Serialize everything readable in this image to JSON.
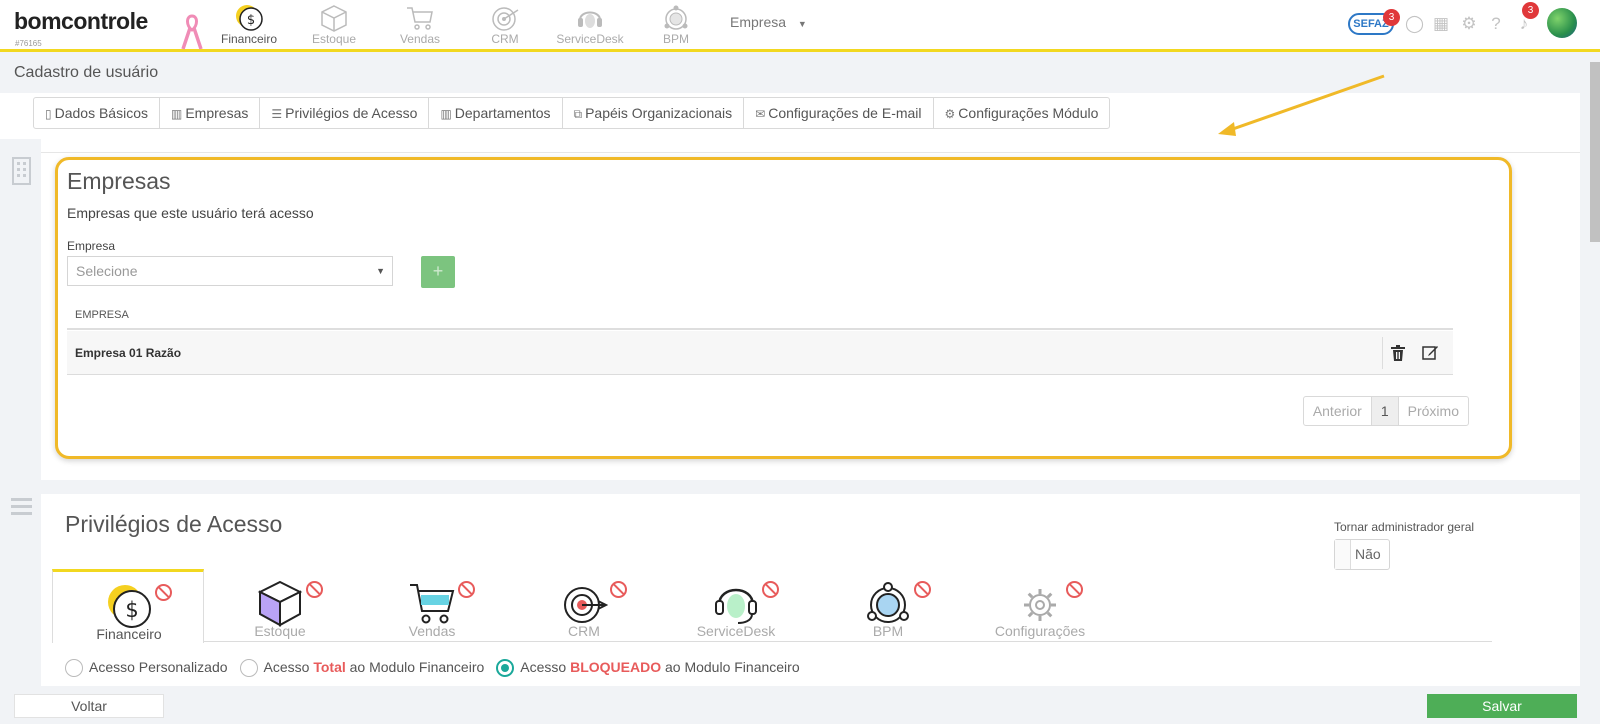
{
  "app": {
    "logo": "bomcontrole",
    "account_id": "#76165"
  },
  "topnav": {
    "modules": [
      {
        "label": "Financeiro",
        "icon": "dollar-coin-icon"
      },
      {
        "label": "Estoque",
        "icon": "box-icon"
      },
      {
        "label": "Vendas",
        "icon": "cart-icon"
      },
      {
        "label": "CRM",
        "icon": "target-icon"
      },
      {
        "label": "ServiceDesk",
        "icon": "headset-icon"
      },
      {
        "label": "BPM",
        "icon": "network-icon"
      }
    ],
    "empresa_label": "Empresa",
    "sefaz_label": "SEFAZ",
    "sefaz_badge": "3",
    "notifications_badge": "3"
  },
  "page": {
    "title": "Cadastro de usuário"
  },
  "tabs": [
    {
      "label": "Dados Básicos",
      "icon": "file-icon"
    },
    {
      "label": "Empresas",
      "icon": "building-icon"
    },
    {
      "label": "Privilégios de Acesso",
      "icon": "list-icon"
    },
    {
      "label": "Departamentos",
      "icon": "building-icon"
    },
    {
      "label": "Papéis Organizacionais",
      "icon": "sitemap-icon"
    },
    {
      "label": "Configurações de E-mail",
      "icon": "envelope-icon"
    },
    {
      "label": "Configurações Módulo",
      "icon": "gear-icon"
    }
  ],
  "empresas": {
    "title": "Empresas",
    "subtitle": "Empresas que este usuário terá acesso",
    "field_label": "Empresa",
    "select_placeholder": "Selecione",
    "add_label": "+",
    "table_header": "EMPRESA",
    "rows": [
      {
        "name": "Empresa 01 Razão"
      }
    ],
    "pager": {
      "prev": "Anterior",
      "current": "1",
      "next": "Próximo"
    },
    "highlight_color": "#f0b928"
  },
  "privilegios": {
    "title": "Privilégios de Acesso",
    "admin_label": "Tornar administrador geral",
    "admin_value": "Não",
    "module_tabs": [
      {
        "label": "Financeiro",
        "icon": "dollar-coin-icon"
      },
      {
        "label": "Estoque",
        "icon": "box-icon"
      },
      {
        "label": "Vendas",
        "icon": "cart-icon"
      },
      {
        "label": "CRM",
        "icon": "target-icon"
      },
      {
        "label": "ServiceDesk",
        "icon": "headset-icon"
      },
      {
        "label": "BPM",
        "icon": "network-icon"
      },
      {
        "label": "Configurações",
        "icon": "gear-icon"
      }
    ],
    "radios": {
      "opt1": "Acesso Personalizado",
      "opt2_pre": "Acesso",
      "opt2_bold": "Total",
      "opt2_post": "ao Modulo Financeiro",
      "opt3_pre": "Acesso",
      "opt3_bold": "BLOQUEADO",
      "opt3_post": "ao Modulo Financeiro",
      "selected": "opt3"
    }
  },
  "footer": {
    "back_label": "Voltar",
    "save_label": "Salvar"
  },
  "colors": {
    "accent_yellow": "#f2d820",
    "save_green": "#4eae57",
    "radio_teal": "#1aa89a",
    "block_red": "#e85b5b"
  }
}
